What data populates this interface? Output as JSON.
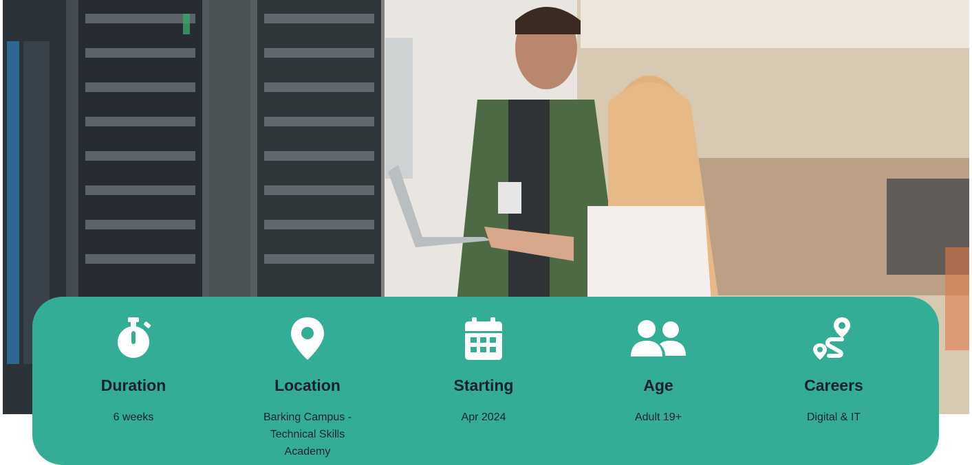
{
  "colors": {
    "panel": "#33ad96",
    "text": "#15212b",
    "icon": "#ffffff"
  },
  "hero": {
    "image": "photo-two-people-with-laptop-beside-server-racks"
  },
  "details": [
    {
      "icon": "stopwatch-icon",
      "label": "Duration",
      "value": "6 weeks"
    },
    {
      "icon": "map-pin-icon",
      "label": "Location",
      "value": "Barking Campus - Technical Skills Academy"
    },
    {
      "icon": "calendar-icon",
      "label": "Starting",
      "value": "Apr 2024"
    },
    {
      "icon": "user-group-icon",
      "label": "Age",
      "value": "Adult 19+"
    },
    {
      "icon": "route-icon",
      "label": "Careers",
      "value": "Digital & IT"
    }
  ]
}
